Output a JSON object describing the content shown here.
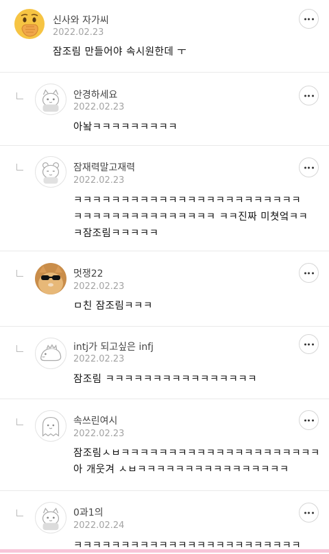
{
  "comments": [
    {
      "nickname": "신사와 자가씨",
      "date": "2022.02.23",
      "text": "잠조림 만들어야 속시원한데 ㅜ",
      "avatar": "hand-over-mouth-emoji",
      "is_reply": false
    },
    {
      "nickname": "안경하세요",
      "date": "2022.02.23",
      "text": "아놬ㅋㅋㅋㅋㅋㅋㅋㅋㅋ",
      "avatar": "default-cat-avatar",
      "is_reply": true
    },
    {
      "nickname": "잠재력말고재력",
      "date": "2022.02.23",
      "text": "ㅋㅋㅋㅋㅋㅋㅋㅋㅋㅋㅋㅋㅋㅋㅋㅋㅋㅋㅋㅋㅋㅋㅋㅋ\nㅋㅋㅋㅋㅋㅋㅋㅋㅋㅋㅋㅋㅋㅋㅋ ㅋㅋ진짜 미쳣엌ㅋㅋ\nㅋ잠조림ㅋㅋㅋㅋㅋ",
      "avatar": "default-bear-avatar",
      "is_reply": true
    },
    {
      "nickname": "멋쟁22",
      "date": "2022.02.23",
      "text": "ㅁ친 잠조림ㅋㅋㅋ",
      "avatar": "cat-with-sunglasses-photo",
      "is_reply": true
    },
    {
      "nickname": "intj가 되고싶은 infj",
      "date": "2022.02.23",
      "text": "잠조림 ㅋㅋㅋㅋㅋㅋㅋㅋㅋㅋㅋㅋㅋㅋㅋㅋ",
      "avatar": "default-dino-avatar",
      "is_reply": true
    },
    {
      "nickname": "속쓰린여시",
      "date": "2022.02.23",
      "text": "잠조림ㅅㅂㅋㅋㅋㅋㅋㅋㅋㅋㅋㅋㅋㅋㅋㅋㅋㅋㅋㅋㅋㅋㅋ\n아 개웃겨 ㅅㅂㅋㅋㅋㅋㅋㅋㅋㅋㅋㅋㅋㅋㅋㅋㅋㅋ",
      "avatar": "default-ghost-avatar",
      "is_reply": true
    },
    {
      "nickname": "0과1의",
      "date": "2022.02.24",
      "text": "ㅋㅋㅋㅋㅋㅋㅋㅋㅋㅋㅋㅋㅋㅋㅋㅋㅋㅋㅋㅋㅋㅋㅋㅋ",
      "avatar": "default-cat-avatar",
      "is_reply": true
    }
  ],
  "more_button_icon": "more-dots-icon",
  "colors": {
    "accent_bottom_bar": "#f7c6d9",
    "date_gray": "#a3a3a3",
    "divider": "#e9e9e9"
  }
}
